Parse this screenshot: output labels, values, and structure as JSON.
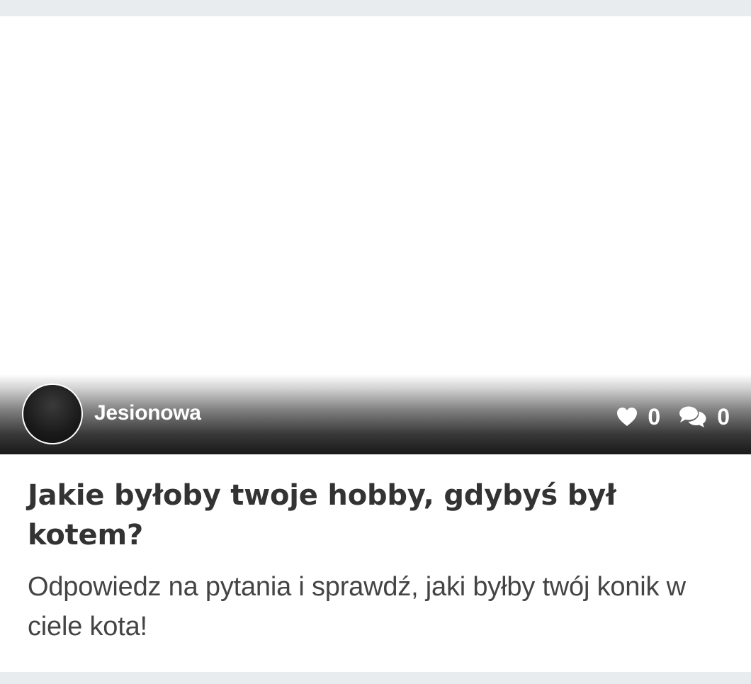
{
  "post": {
    "author": "Jesionowa",
    "likes": "0",
    "comments": "0",
    "title": "Jakie byłoby twoje hobby, gdybyś był kotem?",
    "description": "Odpowiedz na pytania i sprawdź, jaki byłby twój konik w ciele kota!"
  },
  "icons": {
    "likes": "heart-icon",
    "comments": "comments-icon"
  },
  "colors": {
    "page_background": "#e8ecee",
    "card_background": "#ffffff",
    "title_text": "#333333",
    "description_text": "#444444",
    "overlay_text": "#ffffff"
  }
}
